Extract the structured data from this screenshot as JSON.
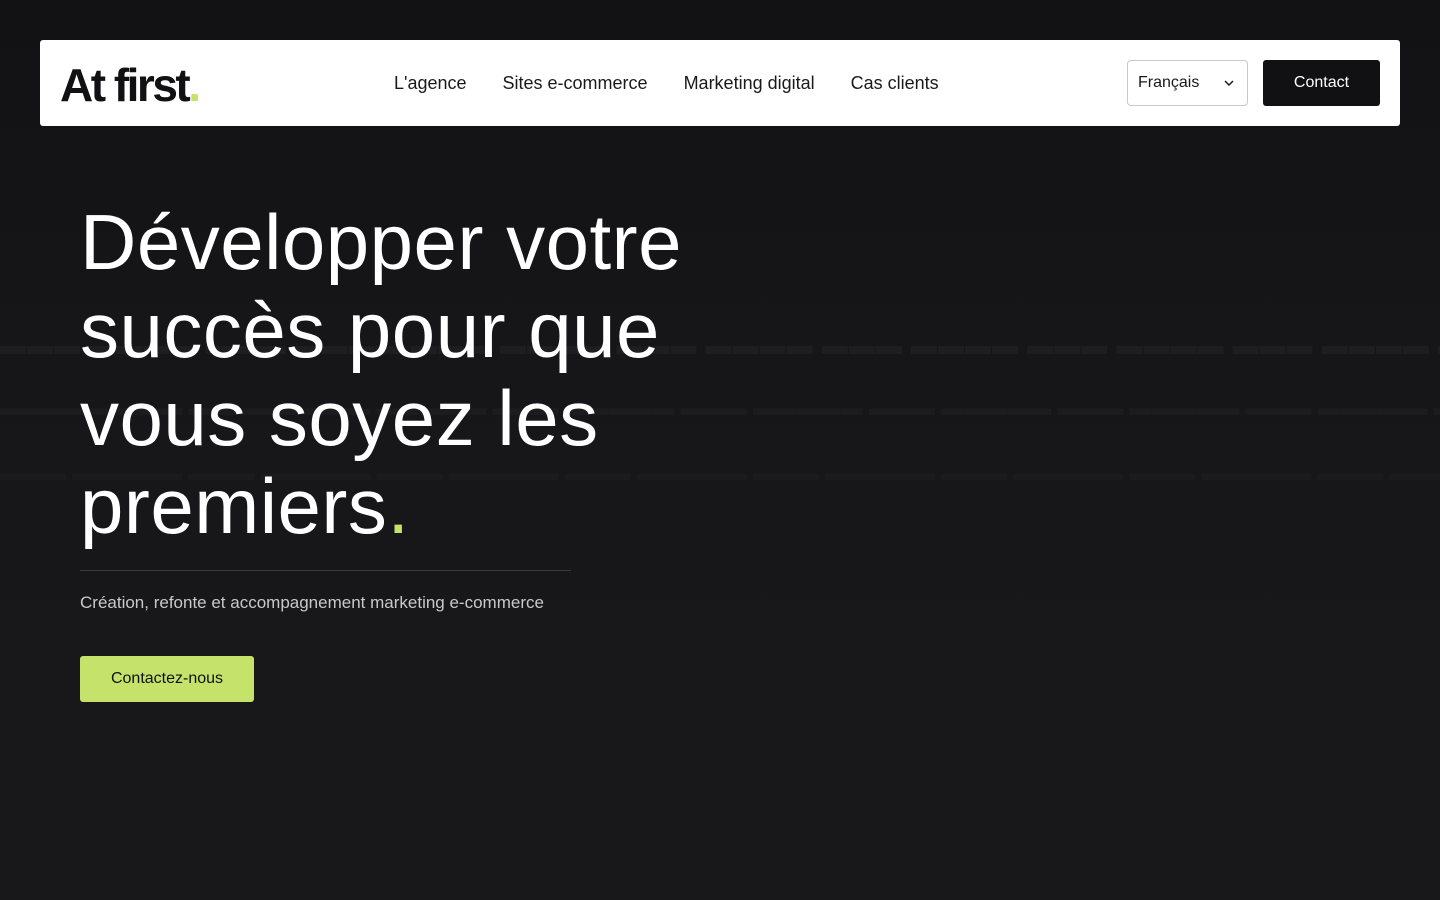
{
  "header": {
    "logo_text": "At first",
    "logo_dot": ".",
    "nav": [
      {
        "label": "L'agence"
      },
      {
        "label": "Sites e-commerce"
      },
      {
        "label": "Marketing digital"
      },
      {
        "label": "Cas clients"
      }
    ],
    "language": {
      "selected": "Français",
      "icon": "chevron-down-icon"
    },
    "contact_label": "Contact"
  },
  "hero": {
    "title": "Développer votre succès pour que vous soyez les premiers",
    "title_dot": ".",
    "subtitle": "Création, refonte et accompagnement marketing e-commerce",
    "cta_label": "Contactez-nous"
  },
  "colors": {
    "background": "#161618",
    "accent": "#c5e26b",
    "header_bg": "#ffffff",
    "button_dark": "#111113"
  }
}
